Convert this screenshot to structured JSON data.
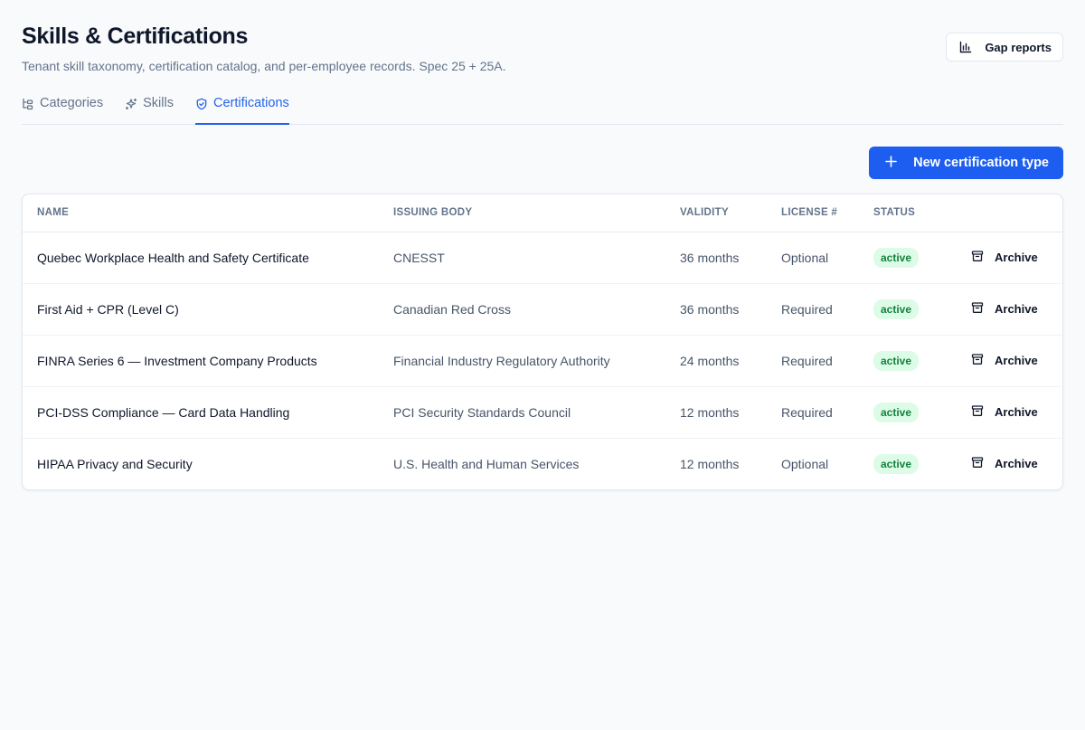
{
  "header": {
    "title": "Skills & Certifications",
    "subtitle": "Tenant skill taxonomy, certification catalog, and per-employee records. Spec 25 + 25A.",
    "gap_reports_label": "Gap reports"
  },
  "tabs": [
    {
      "label": "Categories",
      "icon": "hierarchy-icon",
      "active": false
    },
    {
      "label": "Skills",
      "icon": "sparkle-icon",
      "active": false
    },
    {
      "label": "Certifications",
      "icon": "shield-check-icon",
      "active": true
    }
  ],
  "actions": {
    "new_label": "New certification type"
  },
  "table": {
    "headers": [
      "NAME",
      "ISSUING BODY",
      "VALIDITY",
      "LICENSE #",
      "STATUS"
    ],
    "archive_label": "Archive",
    "rows": [
      {
        "name": "Quebec Workplace Health and Safety Certificate",
        "issuer": "CNESST",
        "validity": "36 months",
        "license": "Optional",
        "status": "active"
      },
      {
        "name": "First Aid + CPR (Level C)",
        "issuer": "Canadian Red Cross",
        "validity": "36 months",
        "license": "Required",
        "status": "active"
      },
      {
        "name": "FINRA Series 6 — Investment Company Products",
        "issuer": "Financial Industry Regulatory Authority",
        "validity": "24 months",
        "license": "Required",
        "status": "active"
      },
      {
        "name": "PCI-DSS Compliance — Card Data Handling",
        "issuer": "PCI Security Standards Council",
        "validity": "12 months",
        "license": "Required",
        "status": "active"
      },
      {
        "name": "HIPAA Privacy and Security",
        "issuer": "U.S. Health and Human Services",
        "validity": "12 months",
        "license": "Optional",
        "status": "active"
      }
    ]
  },
  "colors": {
    "accent": "#1d5ef0",
    "active_tab": "#2563eb",
    "badge_bg": "#dcfce7",
    "badge_text": "#15803d"
  }
}
